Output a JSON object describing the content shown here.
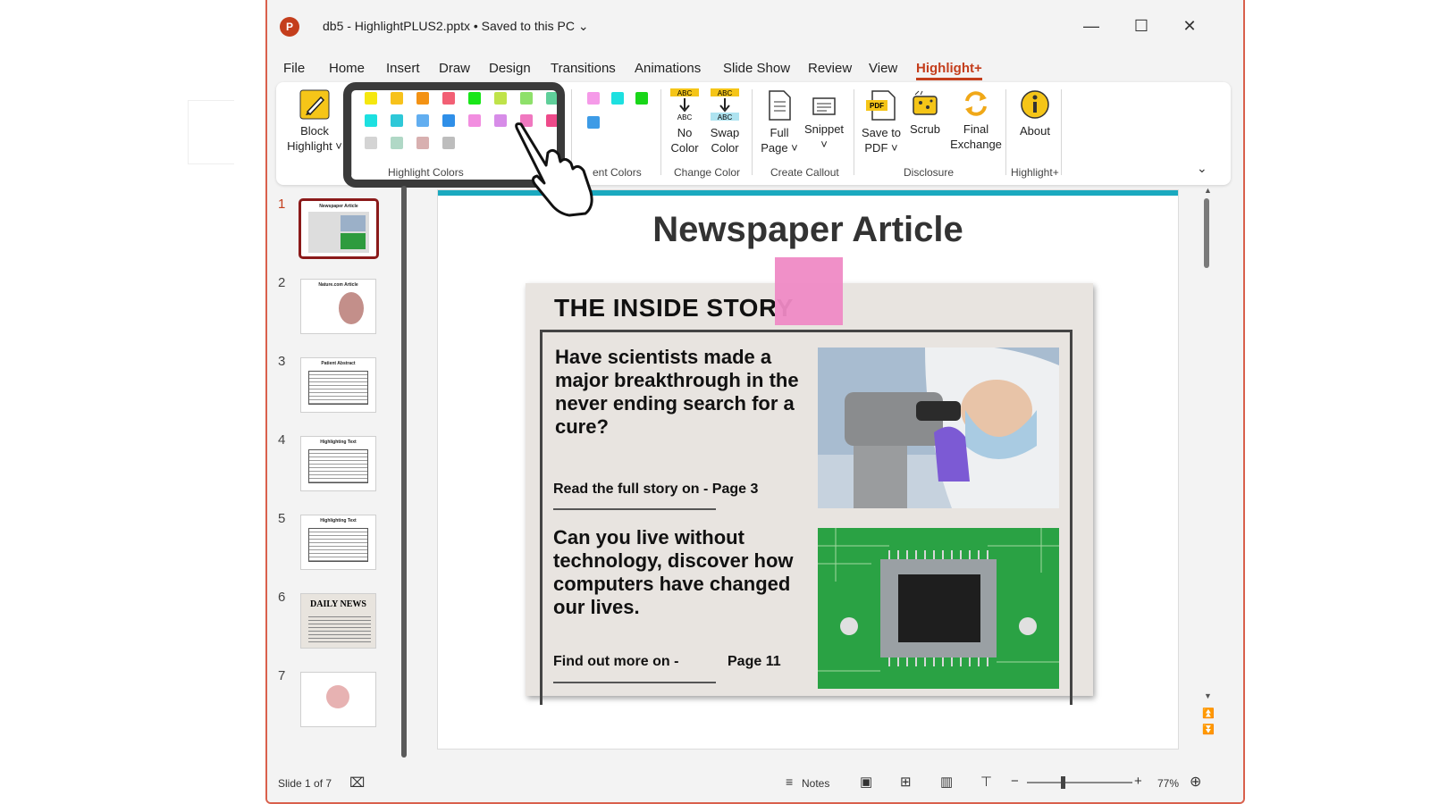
{
  "window": {
    "title": "db5 - HighlightPLUS2.pptx • Saved to this PC",
    "app_icon_letter": "P",
    "controls": [
      "—",
      "☐",
      "✕"
    ]
  },
  "menu": {
    "tabs": [
      "File",
      "Home",
      "Insert",
      "Draw",
      "Design",
      "Transitions",
      "Animations",
      "Slide Show",
      "Review",
      "View",
      "Highlight+"
    ],
    "active": "Highlight+"
  },
  "ribbon": {
    "block_highlight": "Block\nHighlight ˅",
    "highlight_colors_label": "Highlight Colors",
    "recent_colors_label": "ent Colors",
    "no_color": "No\nColor",
    "swap_color": "Swap\nColor",
    "change_color_label": "Change Color",
    "full_page": "Full\nPage ˅",
    "snippet": "Snippet\n˅",
    "create_callout_label": "Create Callout",
    "save_to_pdf": "Save to\nPDF ˅",
    "scrub": "Scrub",
    "final_exchange": "Final\nExchange",
    "disclosure_label": "Disclosure",
    "about": "About",
    "highlightplus_label": "Highlight+",
    "abc": "ABC",
    "pdf": "PDF",
    "highlight_swatches": [
      "#f5e70f",
      "#f7c21b",
      "#f39214",
      "#f25f74",
      "#19e619",
      "#bfe34a",
      "#8ee06a",
      "#5fcf9a",
      "#1de0e0",
      "#2ec8d8",
      "#62aef0",
      "#2f8fe8",
      "#f28ee0",
      "#d78ce8",
      "#f078c0",
      "#ee4a8a",
      "#d4d4d4",
      "#b0d8c6",
      "#d8b0b0",
      "#bdbdbd"
    ],
    "recent_swatches": [
      "#f59ae8",
      "#1de0e0",
      "#19d619",
      "#3d9be6"
    ]
  },
  "slides": {
    "numbers": [
      "1",
      "2",
      "3",
      "4",
      "5",
      "6",
      "7"
    ],
    "thumb_titles": [
      "Newspaper Article",
      "Nature.com Article",
      "Patient Abstract",
      "Highlighting Text",
      "Highlighting Text",
      "DAILY NEWS",
      ""
    ]
  },
  "slide": {
    "title": "Newspaper Article",
    "paper_headline": "THE INSIDE STORY",
    "story1": "Have scientists made a major breakthrough in the never ending search for a cure?",
    "read_more": "Read the full story on -  Page 3",
    "story2": "Can you live without technology, discover how computers have changed our lives.",
    "find_more": "Find out more on -",
    "find_page": "Page 11"
  },
  "status": {
    "slide_count": "Slide 1 of 7",
    "notes": "Notes",
    "zoom": "77%"
  },
  "colors": {
    "accent": "#c43e1c",
    "slide_bar": "#1aa9bf",
    "highlight_pink": "#ef8ac5"
  }
}
